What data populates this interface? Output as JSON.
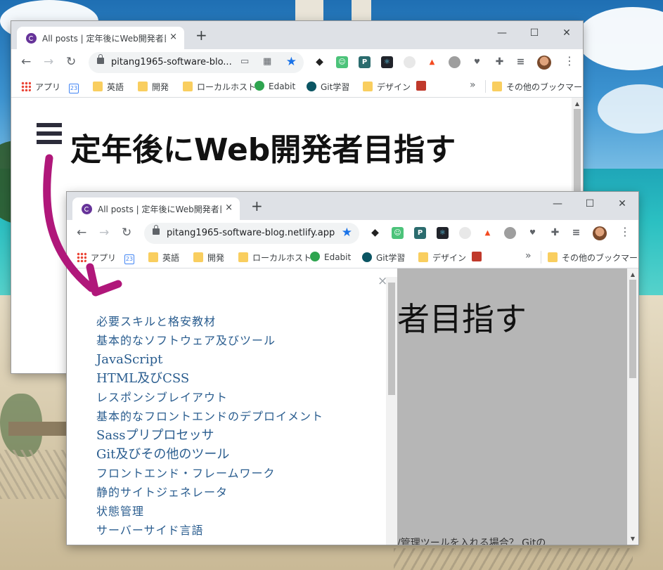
{
  "back_window": {
    "tab_title": "All posts | 定年後にWeb開発者目指",
    "url": "pitang1965-software-blo...",
    "site_title": "定年後にWeb開発者目指す"
  },
  "front_window": {
    "tab_title": "All posts | 定年後にWeb開発者目指",
    "url": "pitang1965-software-blog.netlify.app",
    "background_title": "者目指す",
    "background_fragment": "/管理ツールを入れる場合？ Gitの",
    "drawer_close": "×",
    "nav_items": [
      "必要スキルと格安教材",
      "基本的なソフトウェア及びツール",
      "JavaScript",
      "HTML及びCSS",
      "レスポンシブレイアウト",
      "基本的なフロントエンドのデプロイメント",
      "Sassプリプロセッサ",
      "Git及びその他のツール",
      "フロントエンド・フレームワーク",
      "静的サイトジェネレータ",
      "状態管理",
      "サーバーサイド言語"
    ]
  },
  "window_controls": {
    "close_tab": "×",
    "new_tab": "+",
    "minimize": "—",
    "maximize": "☐",
    "close": "✕"
  },
  "bookmarks": {
    "apps": "アプリ",
    "calendar": "23",
    "english": "英語",
    "dev": "開発",
    "localhost": "ローカルホスト",
    "edabit": "Edabit",
    "git": "Git学習",
    "design": "デザイン",
    "overflow": "»",
    "others": "その他のブックマーク"
  },
  "colors": {
    "arrow": "#b0177a",
    "link": "#2a5d8f",
    "accent": "#1a73e8",
    "gatsby": "#663399"
  }
}
